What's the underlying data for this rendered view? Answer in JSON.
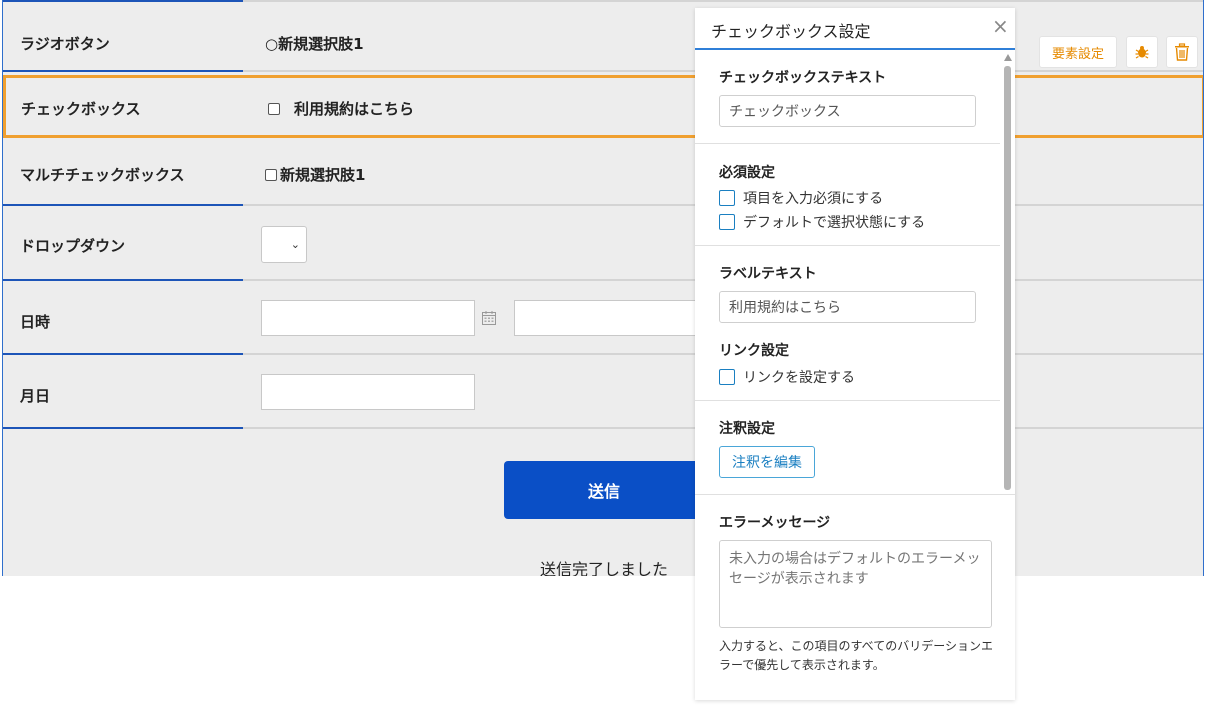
{
  "form": {
    "rows": [
      {
        "label": "ラジオボタン",
        "value": "○新規選択肢1"
      },
      {
        "label": "チェックボックス",
        "value": "利用規約はこちら"
      },
      {
        "label": "マルチチェックボックス",
        "value": "新規選択肢1"
      },
      {
        "label": "ドロップダウン"
      },
      {
        "label": "日時"
      },
      {
        "label": "月日"
      }
    ],
    "submit_label": "送信",
    "complete_text": "送信完了しました",
    "dropdown_chevron": "⌄"
  },
  "toolbar": {
    "element_settings_label": "要素設定",
    "bug_icon": "bug-icon",
    "trash_icon": "trash-icon",
    "accent_color": "#e68a00"
  },
  "panel": {
    "title": "チェックボックス設定",
    "close_glyph": "×",
    "checkbox_text": {
      "title": "チェックボックステキスト",
      "value": "チェックボックス"
    },
    "required": {
      "title": "必須設定",
      "options": [
        "項目を入力必須にする",
        "デフォルトで選択状態にする"
      ]
    },
    "label_text": {
      "title": "ラベルテキスト",
      "value": "利用規約はこちら"
    },
    "link": {
      "title": "リンク設定",
      "option": "リンクを設定する"
    },
    "note": {
      "title": "注釈設定",
      "button_label": "注釈を編集"
    },
    "error": {
      "title": "エラーメッセージ",
      "placeholder": "未入力の場合はデフォルトのエラーメッセージが表示されます",
      "help": "入力すると、この項目のすべてのバリデーションエラーで優先して表示されます。"
    }
  },
  "colors": {
    "primary_blue": "#0a4fc6",
    "selection_orange": "#f0a030",
    "panel_accent": "#2f7fd8"
  }
}
